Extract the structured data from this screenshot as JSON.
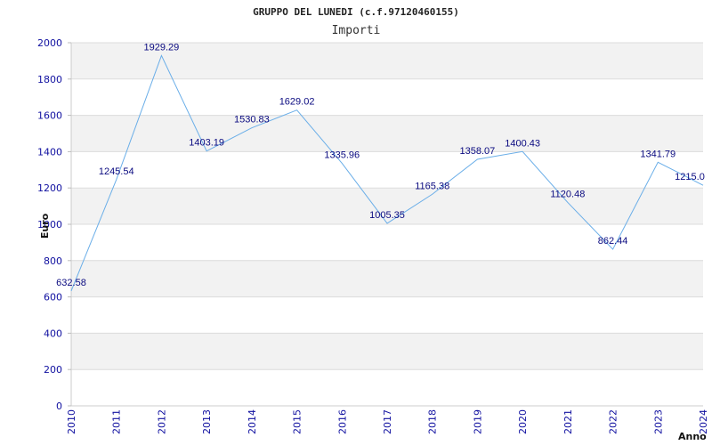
{
  "chart_data": {
    "type": "line",
    "title": "GRUPPO DEL LUNEDI (c.f.97120460155)",
    "subtitle": "Importi",
    "xlabel": "Anno",
    "ylabel": "Euro",
    "x": [
      "2010",
      "2011",
      "2012",
      "2013",
      "2014",
      "2015",
      "2016",
      "2017",
      "2018",
      "2019",
      "2020",
      "2021",
      "2022",
      "2023",
      "2024"
    ],
    "values": [
      632.58,
      1245.54,
      1929.29,
      1403.19,
      1530.83,
      1629.02,
      1335.96,
      1005.35,
      1165.38,
      1358.07,
      1400.43,
      1120.48,
      862.44,
      1341.79,
      1215.0
    ],
    "data_labels": [
      "632.58",
      "1245.54",
      "1929.29",
      "1403.19",
      "1530.83",
      "1629.02",
      "1335.96",
      "1005.35",
      "1165.38",
      "1358.07",
      "1400.43",
      "1120.48",
      "862.44",
      "1341.79",
      "1215.0"
    ],
    "y_ticks": [
      "0",
      "200",
      "400",
      "600",
      "800",
      "1000",
      "1200",
      "1400",
      "1600",
      "1800",
      "2000"
    ],
    "ylim": [
      0,
      2000
    ],
    "grid": true,
    "line_color": "#6aaee8",
    "band_color": "#f2f2f2",
    "tick_color": "#1010a0",
    "label_color": "#0a0a80"
  }
}
